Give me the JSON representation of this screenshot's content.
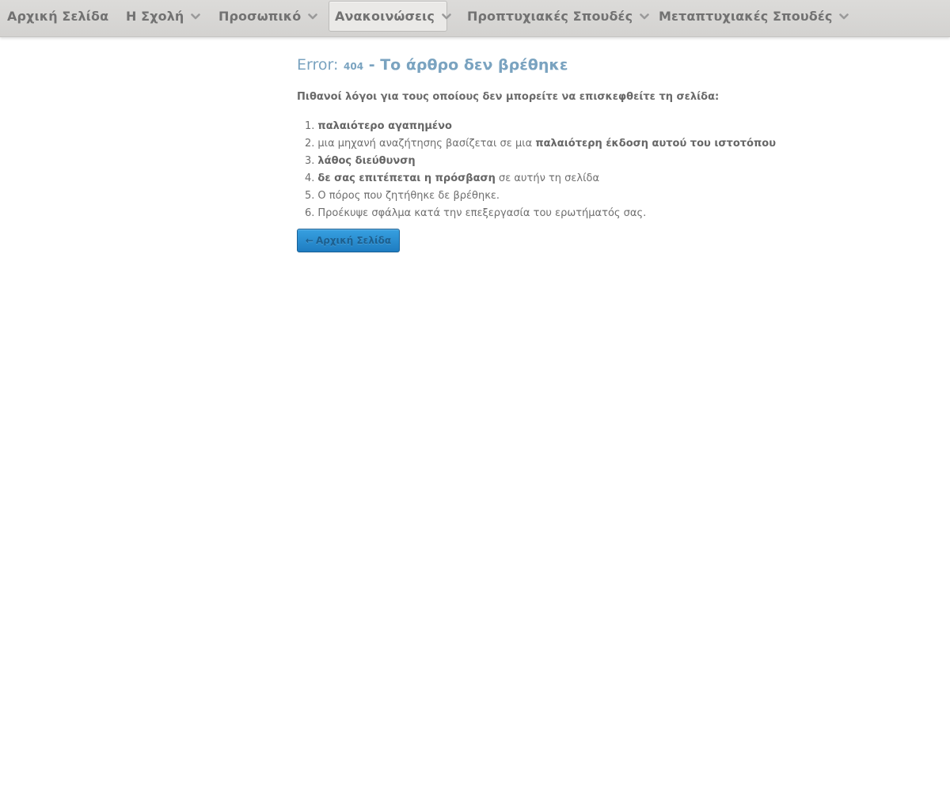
{
  "nav": {
    "items": [
      {
        "label": "Αρχική Σελίδα",
        "has_dropdown": false,
        "active": false
      },
      {
        "label": "Η Σχολή",
        "has_dropdown": true,
        "active": false
      },
      {
        "label": "Προσωπικό",
        "has_dropdown": true,
        "active": false
      },
      {
        "label": "Ανακοινώσεις",
        "has_dropdown": true,
        "active": true
      },
      {
        "label": "Προπτυχιακές Σπουδές",
        "has_dropdown": true,
        "active": false
      },
      {
        "label": "Μεταπτυχιακές Σπουδές",
        "has_dropdown": true,
        "active": false
      }
    ]
  },
  "error": {
    "label": "Error:",
    "code": "404",
    "separator": "-",
    "message": "Το άρθρο δεν βρέθηκε",
    "reasons_intro": "Πιθανοί λόγοι για τους οποίους δεν μπορείτε να επισκεφθείτε τη σελίδα:",
    "reasons": [
      {
        "num": "1.",
        "pre": "",
        "bold": "παλαιότερο αγαπημένο",
        "post": ""
      },
      {
        "num": "2.",
        "pre": "μια μηχανή αναζήτησης βασίζεται σε μια ",
        "bold": "παλαιότερη έκδοση αυτού του ιστοτόπου",
        "post": ""
      },
      {
        "num": "3.",
        "pre": "",
        "bold": "λάθος διεύθυνση",
        "post": ""
      },
      {
        "num": "4.",
        "pre": "",
        "bold": "δε σας επιτέπεται η πρόσβαση",
        "post": " σε αυτήν τη σελίδα"
      },
      {
        "num": "5.",
        "pre": "Ο πόρος που ζητήθηκε δε βρέθηκε.",
        "bold": "",
        "post": ""
      },
      {
        "num": "6.",
        "pre": "Προέκυψε σφάλμα κατά την επεξεργασία του ερωτήματός σας.",
        "bold": "",
        "post": ""
      }
    ],
    "home_button": {
      "arrow": "←",
      "label": "Αρχική Σελίδα"
    }
  },
  "colors": {
    "navbar_bg": "#d6d5d3",
    "title": "#7aa3c0",
    "button": "#2a8fd6"
  },
  "icons": {
    "dropdown": "chevron-down-icon",
    "back": "arrow-left-icon"
  }
}
